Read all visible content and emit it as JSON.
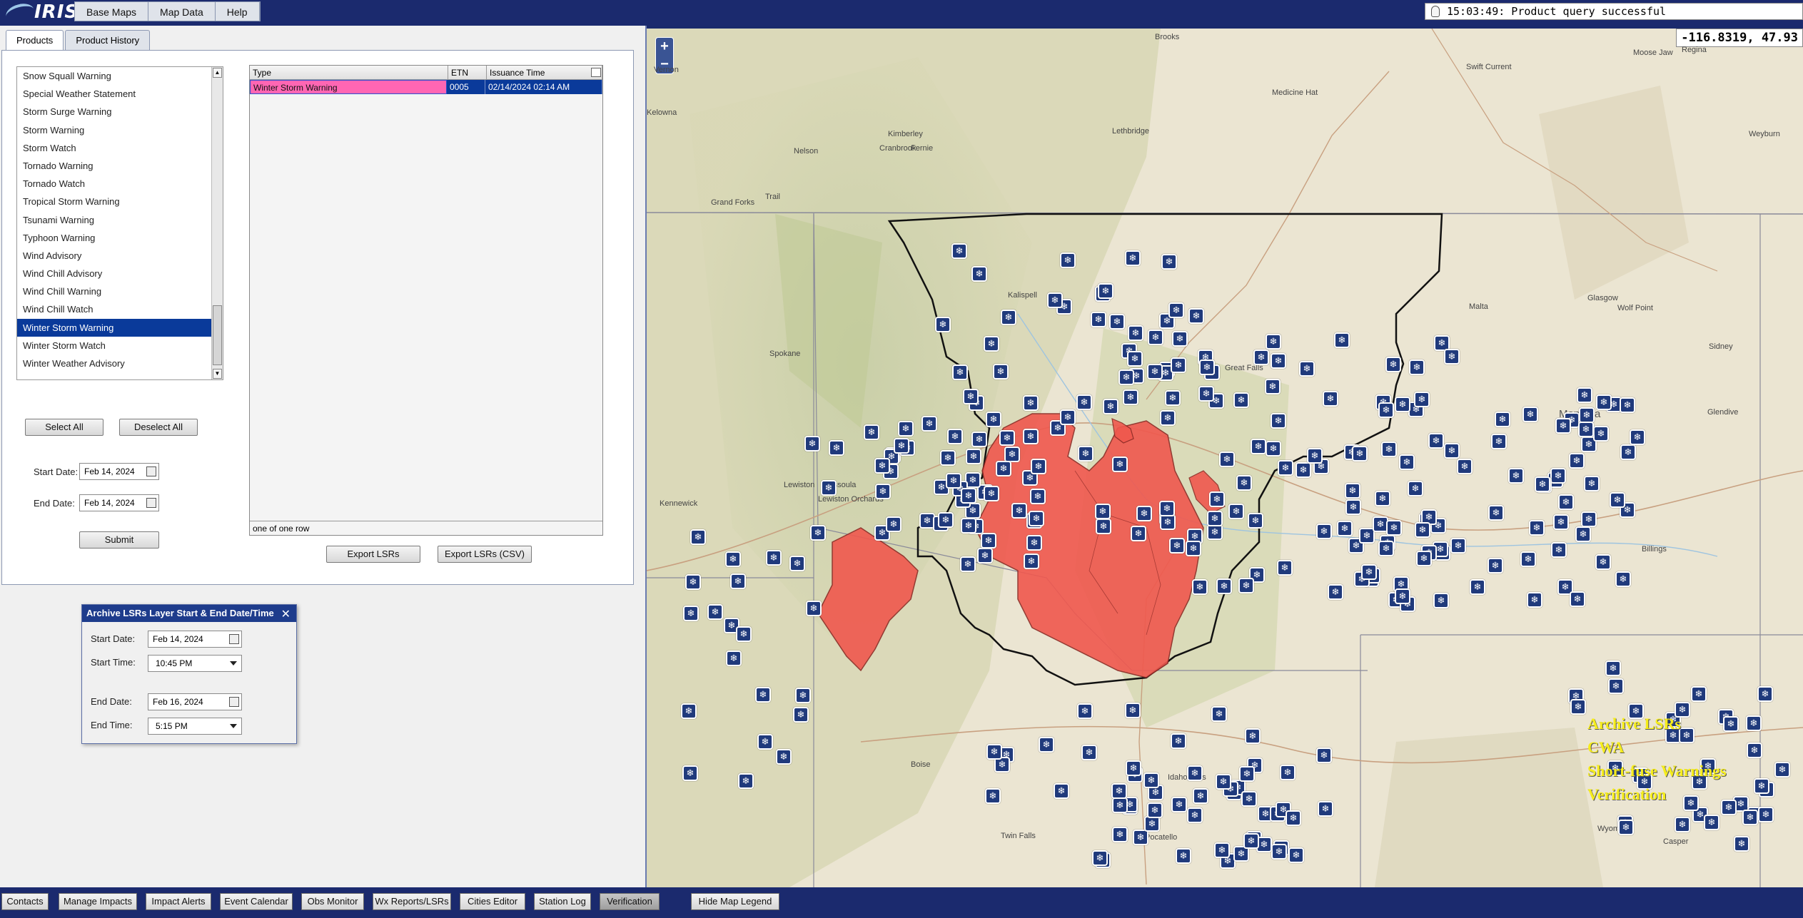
{
  "app": {
    "logo_text": "IRIS"
  },
  "menu": {
    "items": [
      "Base Maps",
      "Map Data",
      "Help"
    ]
  },
  "status": {
    "message": "15:03:49: Product query successful"
  },
  "tabs": [
    "Products",
    "Product History"
  ],
  "product_types": [
    "Snow Squall Warning",
    "Special Weather Statement",
    "Storm Surge Warning",
    "Storm Warning",
    "Storm Watch",
    "Tornado Warning",
    "Tornado Watch",
    "Tropical Storm Warning",
    "Tsunami Warning",
    "Typhoon Warning",
    "Wind Advisory",
    "Wind Chill Advisory",
    "Wind Chill Warning",
    "Wind Chill Watch",
    "Winter Storm Warning",
    "Winter Storm Watch",
    "Winter Weather Advisory"
  ],
  "selected_type": "Winter Storm Warning",
  "buttons": {
    "select_all": "Select All",
    "deselect_all": "Deselect All",
    "submit": "Submit",
    "export_lsrs": "Export LSRs",
    "export_lsrs_csv": "Export LSRs (CSV)"
  },
  "filters": {
    "start_label": "Start Date:",
    "start_value": "Feb 14, 2024",
    "end_label": "End Date:",
    "end_value": "Feb 14, 2024"
  },
  "results": {
    "columns": [
      "Type",
      "ETN",
      "Issuance Time"
    ],
    "rows": [
      {
        "type": "Winter Storm Warning",
        "etn": "0005",
        "time": "02/14/2024 02:14 AM"
      }
    ],
    "footer": "one of one row"
  },
  "archive": {
    "title": "Archive LSRs Layer Start & End Date/Time",
    "start_date_label": "Start Date:",
    "start_date": "Feb 14, 2024",
    "start_time_label": "Start Time:",
    "start_time": "10:45 PM",
    "end_date_label": "End Date:",
    "end_date": "Feb 16, 2024",
    "end_time_label": "End Time:",
    "end_time": "5:15 PM"
  },
  "map": {
    "coords": "-116.8319, 47.93",
    "legend": [
      "Archive LSRs",
      "CWA",
      "Short-fuse Warnings",
      "Verification"
    ],
    "places": [
      "Brooks",
      "Medicine Hat",
      "Swift Current",
      "Moose Jaw",
      "Regina",
      "Lethbridge",
      "Kimberley",
      "Cranbrook",
      "Fernie",
      "Nelson",
      "Trail",
      "Grand Forks",
      "Kelowna",
      "Vernon",
      "Weyburn",
      "Kalispell",
      "Spokane",
      "Great Falls",
      "Malta",
      "Glasgow",
      "Wolf Point",
      "Sidney",
      "Glendive",
      "Montana",
      "Missoula",
      "Lewiston",
      "Lewiston Orchards",
      "Kennewick",
      "Billings",
      "Boise",
      "Idaho Falls",
      "Twin Falls",
      "Pocatello",
      "Wyoming",
      "Casper"
    ],
    "markers_count": 280
  },
  "bottom_buttons": [
    "Contacts",
    "Manage Impacts",
    "Impact Alerts",
    "Event Calendar",
    "Obs Monitor",
    "Wx Reports/LSRs",
    "Cities Editor",
    "Station Log",
    "Verification",
    "Hide Map Legend"
  ],
  "colors": {
    "accent": "#1b2a6e",
    "selected": "#0a3a9a",
    "warning_fill": "#f0584e",
    "legend_text": "#f6ed1b"
  }
}
